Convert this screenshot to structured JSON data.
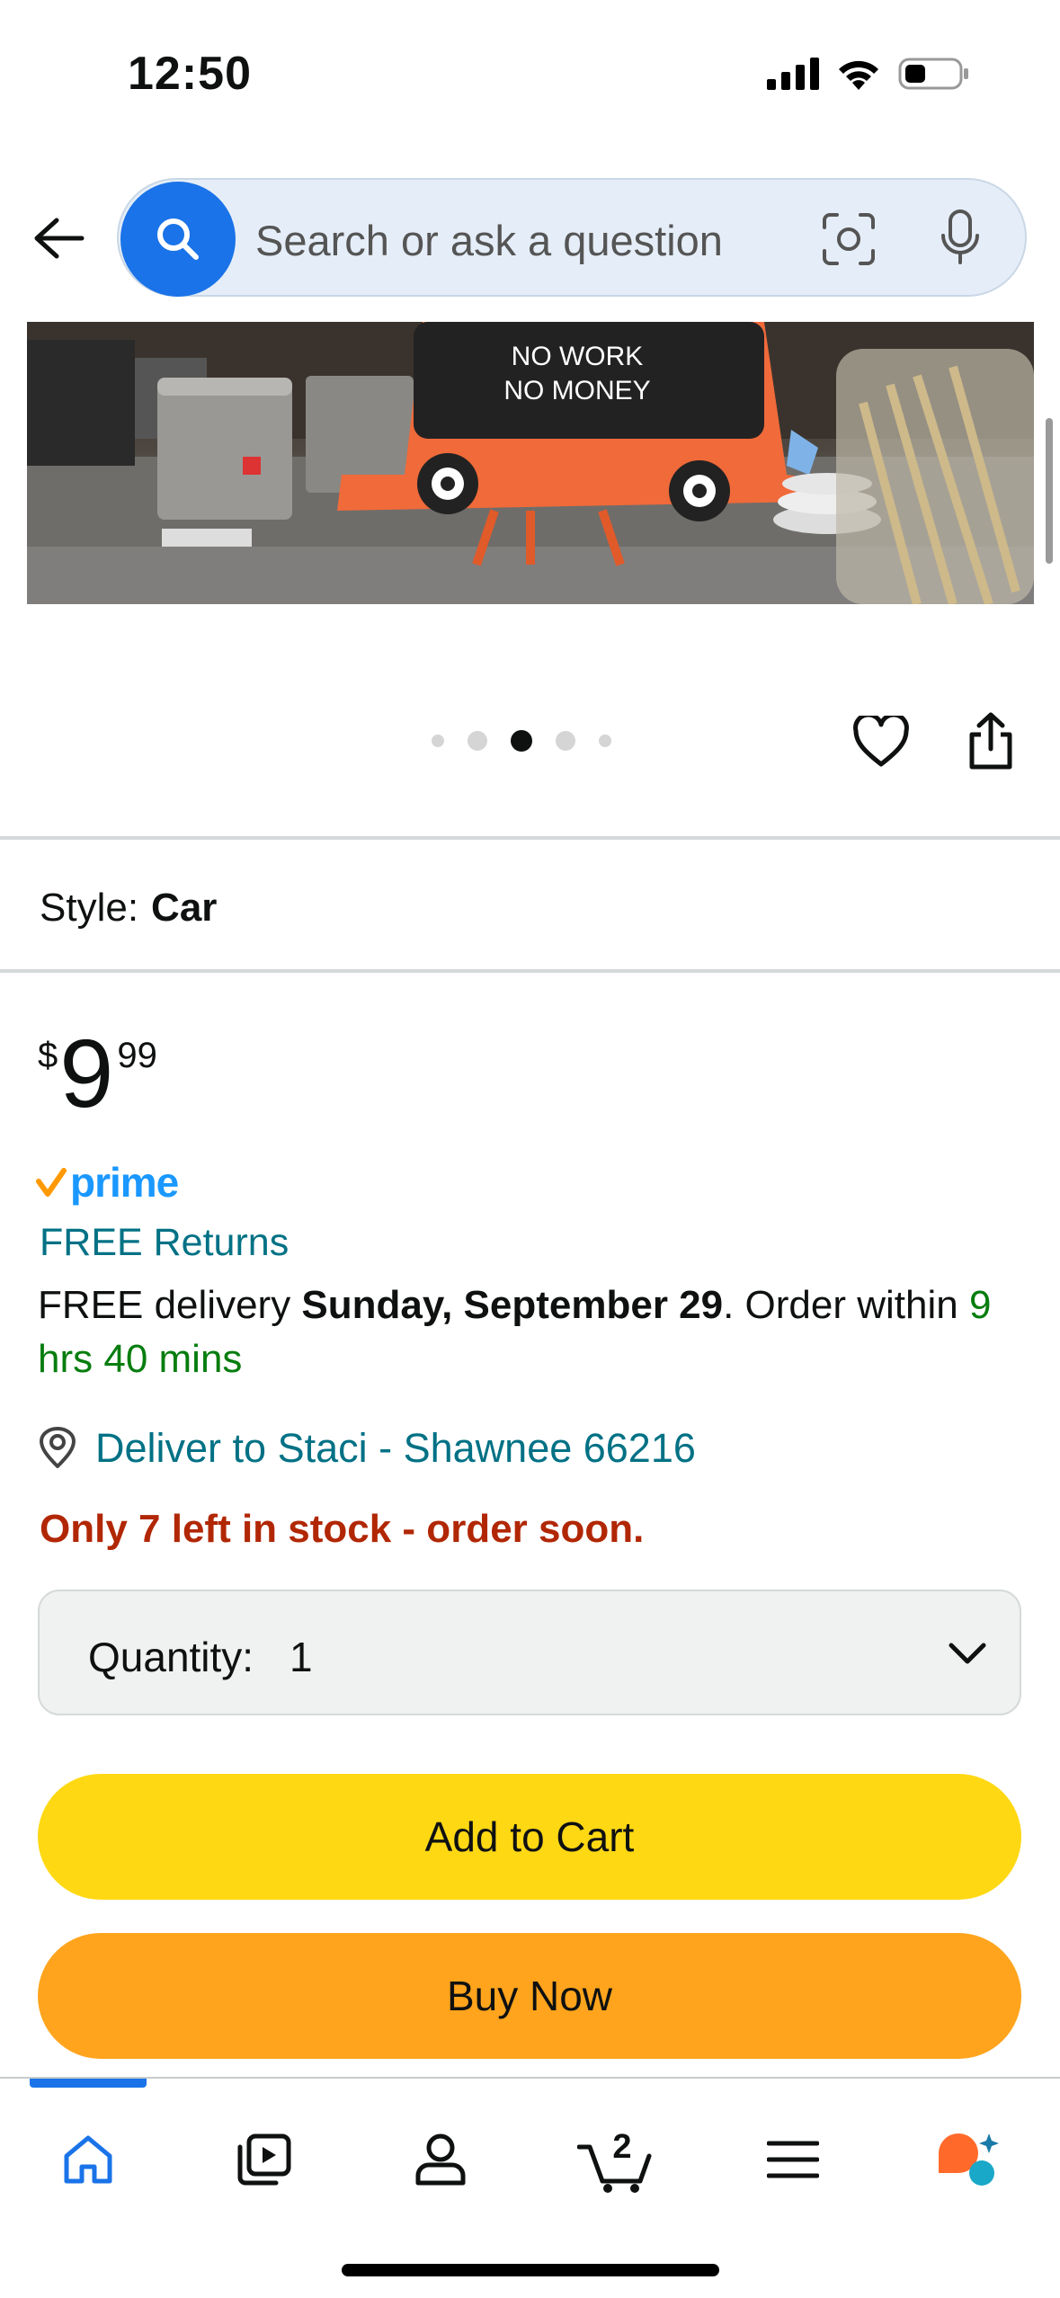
{
  "status_bar": {
    "time": "12:50"
  },
  "search": {
    "placeholder": "Search or ask a question"
  },
  "product_image": {
    "sign_text_line1": "NO WORK",
    "sign_text_line2": "NO MONEY"
  },
  "carousel": {
    "total": 5,
    "active_index": 2
  },
  "style": {
    "label": "Style:",
    "value": "Car"
  },
  "price": {
    "symbol": "$",
    "whole": "9",
    "fraction": "99"
  },
  "prime": {
    "text": "prime"
  },
  "returns": {
    "text": "FREE Returns"
  },
  "delivery": {
    "prefix": "FREE delivery ",
    "date": "Sunday, September 29",
    "middle": ". Order within ",
    "countdown": "9 hrs 40 mins"
  },
  "deliver_to": {
    "text": "Deliver to Staci - Shawnee 66216"
  },
  "stock": {
    "text": "Only 7 left in stock - order soon."
  },
  "quantity": {
    "label": "Quantity:",
    "value": "1"
  },
  "buttons": {
    "add_to_cart": "Add to Cart",
    "buy_now": "Buy Now"
  },
  "tabbar": {
    "cart_count": "2",
    "items": [
      "home-icon",
      "video-icon",
      "account-icon",
      "cart-icon",
      "menu-icon",
      "rufus-icon"
    ],
    "active": "home"
  },
  "colors": {
    "accent_blue": "#1a73e8",
    "link_teal": "#007185",
    "stock_red": "#b12704",
    "green": "#067d0e",
    "add_to_cart": "#ffd814",
    "buy_now": "#ffa41c",
    "prime_blue": "#1a98ff",
    "prime_check": "#ff9900"
  }
}
